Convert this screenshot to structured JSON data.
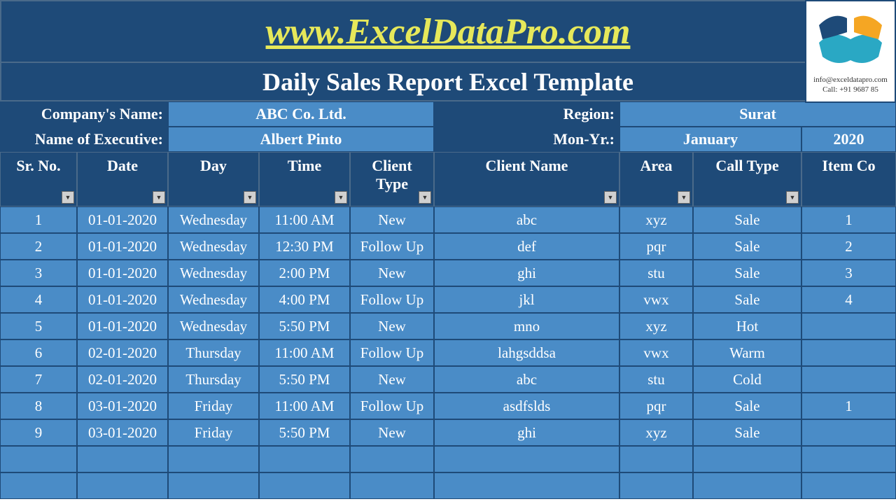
{
  "banner": "www.ExcelDataPro.com",
  "title": "Daily Sales Report Excel Template",
  "contact": {
    "email": "info@exceldatapro.com",
    "phone": "Call: +91 9687 85"
  },
  "meta": {
    "company_label": "Company's Name:",
    "company_value": "ABC Co. Ltd.",
    "region_label": "Region:",
    "region_value": "Surat",
    "exec_label": "Name of Executive:",
    "exec_value": "Albert Pinto",
    "monyr_label": "Mon-Yr.:",
    "monyr_month": "January",
    "monyr_year": "2020"
  },
  "columns": [
    "Sr. No.",
    "Date",
    "Day",
    "Time",
    "Client Type",
    "Client Name",
    "Area",
    "Call Type",
    "Item Co"
  ],
  "rows": [
    {
      "sr": "1",
      "date": "01-01-2020",
      "day": "Wednesday",
      "time": "11:00 AM",
      "ctype": "New",
      "cname": "abc",
      "area": "xyz",
      "calltype": "Sale",
      "item": "1"
    },
    {
      "sr": "2",
      "date": "01-01-2020",
      "day": "Wednesday",
      "time": "12:30 PM",
      "ctype": "Follow Up",
      "cname": "def",
      "area": "pqr",
      "calltype": "Sale",
      "item": "2"
    },
    {
      "sr": "3",
      "date": "01-01-2020",
      "day": "Wednesday",
      "time": "2:00 PM",
      "ctype": "New",
      "cname": "ghi",
      "area": "stu",
      "calltype": "Sale",
      "item": "3"
    },
    {
      "sr": "4",
      "date": "01-01-2020",
      "day": "Wednesday",
      "time": "4:00 PM",
      "ctype": "Follow Up",
      "cname": "jkl",
      "area": "vwx",
      "calltype": "Sale",
      "item": "4"
    },
    {
      "sr": "5",
      "date": "01-01-2020",
      "day": "Wednesday",
      "time": "5:50 PM",
      "ctype": "New",
      "cname": "mno",
      "area": "xyz",
      "calltype": "Hot",
      "item": ""
    },
    {
      "sr": "6",
      "date": "02-01-2020",
      "day": "Thursday",
      "time": "11:00 AM",
      "ctype": "Follow Up",
      "cname": "lahgsddsa",
      "area": "vwx",
      "calltype": "Warm",
      "item": ""
    },
    {
      "sr": "7",
      "date": "02-01-2020",
      "day": "Thursday",
      "time": "5:50 PM",
      "ctype": "New",
      "cname": "abc",
      "area": "stu",
      "calltype": "Cold",
      "item": ""
    },
    {
      "sr": "8",
      "date": "03-01-2020",
      "day": "Friday",
      "time": "11:00 AM",
      "ctype": "Follow Up",
      "cname": "asdfslds",
      "area": "pqr",
      "calltype": "Sale",
      "item": "1"
    },
    {
      "sr": "9",
      "date": "03-01-2020",
      "day": "Friday",
      "time": "5:50 PM",
      "ctype": "New",
      "cname": "ghi",
      "area": "xyz",
      "calltype": "Sale",
      "item": ""
    },
    {
      "sr": "",
      "date": "",
      "day": "",
      "time": "",
      "ctype": "",
      "cname": "",
      "area": "",
      "calltype": "",
      "item": ""
    },
    {
      "sr": "",
      "date": "",
      "day": "",
      "time": "",
      "ctype": "",
      "cname": "",
      "area": "",
      "calltype": "",
      "item": ""
    }
  ]
}
